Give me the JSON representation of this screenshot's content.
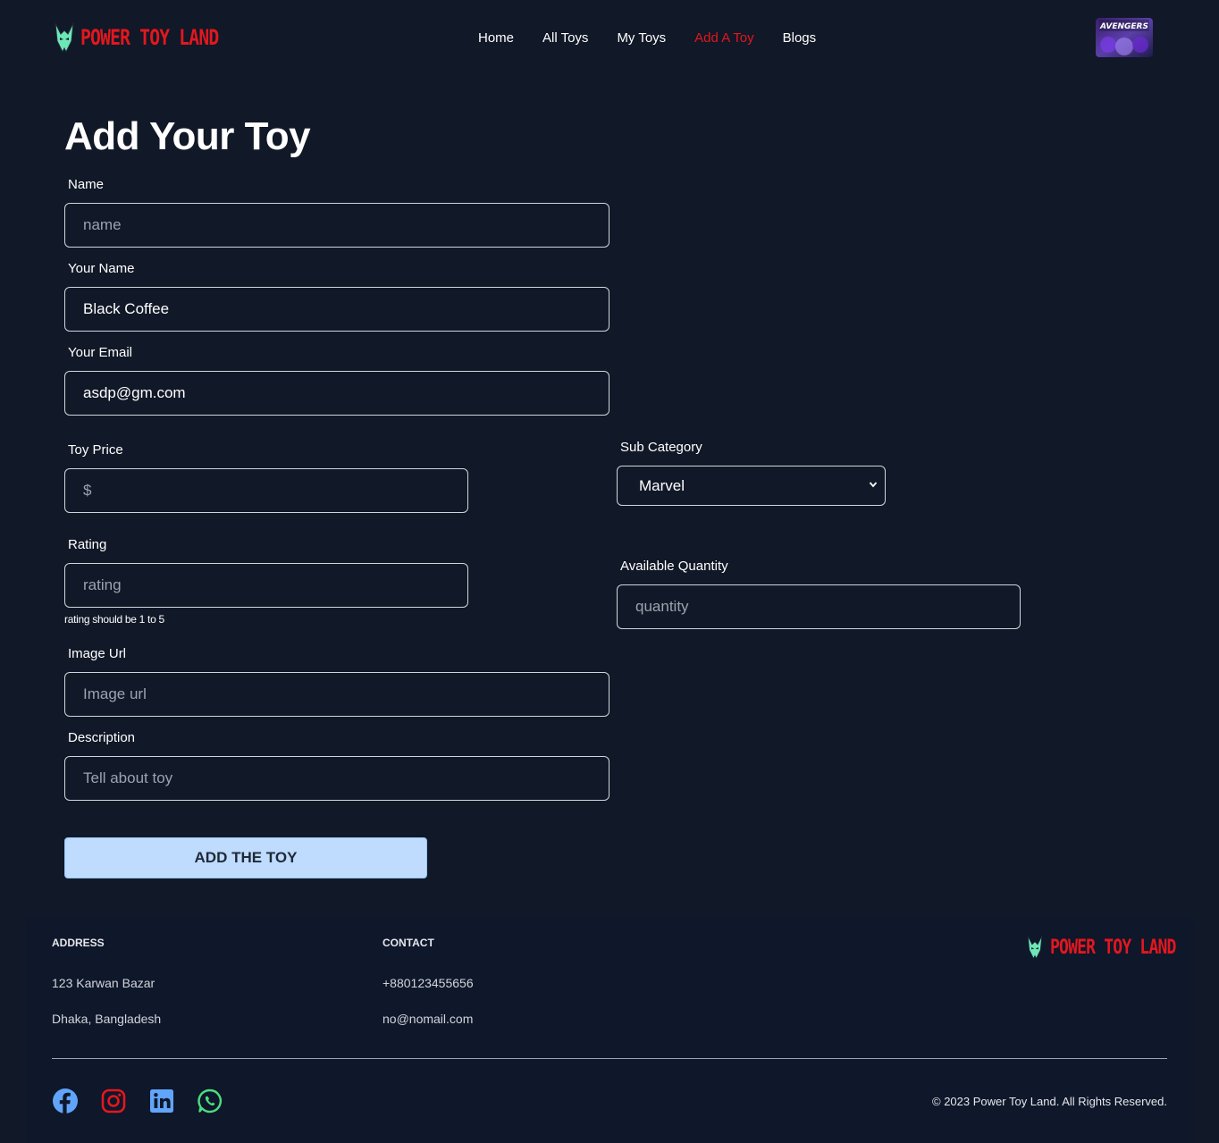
{
  "brand": {
    "name": "POWER TOY LAND",
    "accent": "#e3171e"
  },
  "nav": {
    "items": [
      {
        "label": "Home"
      },
      {
        "label": "All Toys"
      },
      {
        "label": "My Toys"
      },
      {
        "label": "Add A Toy",
        "active": true
      },
      {
        "label": "Blogs"
      }
    ]
  },
  "avatar": {
    "alt": "avengers-poster-avatar",
    "logo_text": "AVENGERS"
  },
  "form": {
    "title": "Add Your Toy",
    "name": {
      "label": "Name",
      "placeholder": "name",
      "value": ""
    },
    "your_name": {
      "label": "Your Name",
      "placeholder": "",
      "value": "Black Coffee"
    },
    "your_email": {
      "label": "Your Email",
      "placeholder": "",
      "value": "asdp@gm.com"
    },
    "toy_price": {
      "label": "Toy Price",
      "placeholder": "$",
      "value": ""
    },
    "sub_category": {
      "label": "Sub Category",
      "selected": "Marvel"
    },
    "rating": {
      "label": "Rating",
      "placeholder": "rating",
      "value": "",
      "hint": "rating should be 1 to 5"
    },
    "available_quantity": {
      "label": "Available Quantity",
      "placeholder": "quantity",
      "value": ""
    },
    "image_url": {
      "label": "Image Url",
      "placeholder": "Image url",
      "value": ""
    },
    "description": {
      "label": "Description",
      "placeholder": "Tell about toy",
      "value": ""
    },
    "submit_label": "ADD THE TOY"
  },
  "footer": {
    "address_heading": "ADDRESS",
    "address_line1": "123 Karwan Bazar",
    "address_line2": "Dhaka, Bangladesh",
    "contact_heading": "CONTACT",
    "phone": "+880123455656",
    "email": "no@nomail.com",
    "brand_name": "POWER TOY LAND",
    "copyright": "© 2023 Power Toy Land. All Rights Reserved.",
    "social": [
      {
        "icon": "facebook-icon",
        "color": "#60a5fa"
      },
      {
        "icon": "instagram-icon",
        "color": "#e3171e"
      },
      {
        "icon": "linkedin-icon",
        "color": "#60a5fa"
      },
      {
        "icon": "whatsapp-icon",
        "color": "#4ade80"
      }
    ]
  }
}
